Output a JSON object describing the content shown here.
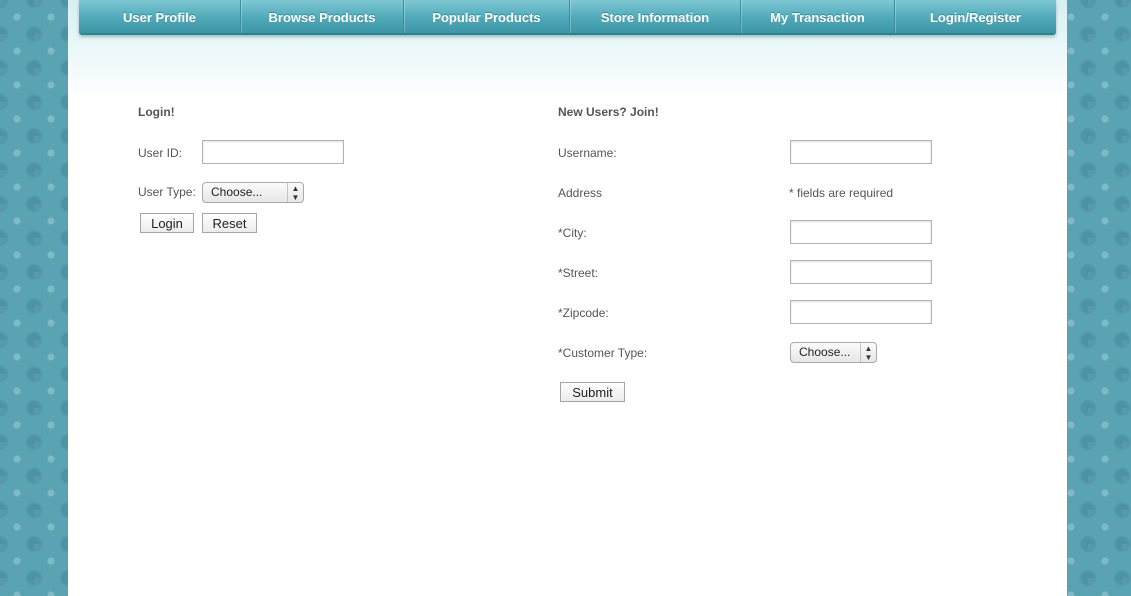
{
  "nav": {
    "items": [
      {
        "label": "User Profile"
      },
      {
        "label": "Browse Products"
      },
      {
        "label": "Popular Products"
      },
      {
        "label": "Store Information"
      },
      {
        "label": "My Transaction"
      },
      {
        "label": "Login/Register"
      }
    ]
  },
  "login": {
    "heading": "Login!",
    "user_id_label": "User ID:",
    "user_id_value": "",
    "user_type_label": "User Type:",
    "user_type_selected": "Choose...",
    "login_button": "Login",
    "reset_button": "Reset"
  },
  "register": {
    "heading": "New Users? Join!",
    "username_label": "Username:",
    "username_value": "",
    "address_label": "Address",
    "required_note": "* fields are required",
    "city_label": "*City:",
    "city_value": "",
    "street_label": "*Street:",
    "street_value": "",
    "zipcode_label": "*Zipcode:",
    "zipcode_value": "",
    "customer_type_label": "*Customer Type:",
    "customer_type_selected": "Choose...",
    "submit_button": "Submit"
  },
  "icons": {
    "select_arrow": "select-updown-arrow-icon"
  },
  "colors": {
    "nav_bar": "#4fa9b9",
    "page_background": "#5aa3b3",
    "content_background": "#ffffff",
    "text": "#555555"
  }
}
